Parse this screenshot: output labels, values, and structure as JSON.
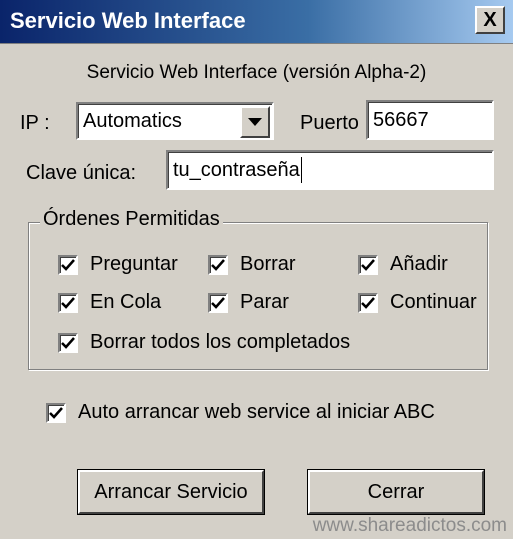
{
  "window": {
    "title": "Servicio Web Interface",
    "close_symbol": "X"
  },
  "version_text": "Servicio Web Interface (versión Alpha-2)",
  "ip": {
    "label": "IP :",
    "value": "Automatics"
  },
  "port": {
    "label": "Puerto",
    "value": "56667"
  },
  "key": {
    "label": "Clave única:",
    "value": "tu_contraseña"
  },
  "permissions": {
    "legend": "Órdenes Permitidas",
    "items": [
      {
        "label": "Preguntar",
        "checked": true
      },
      {
        "label": "Borrar",
        "checked": true
      },
      {
        "label": "Añadir",
        "checked": true
      },
      {
        "label": "En Cola",
        "checked": true
      },
      {
        "label": "Parar",
        "checked": true
      },
      {
        "label": "Continuar",
        "checked": true
      },
      {
        "label": "Borrar todos los completados",
        "checked": true
      }
    ]
  },
  "autostart": {
    "label": "Auto arrancar web service al iniciar ABC",
    "checked": true
  },
  "buttons": {
    "start_label": "Arrancar Servicio",
    "close_label": "Cerrar"
  },
  "watermark": "www.shareadictos.com"
}
